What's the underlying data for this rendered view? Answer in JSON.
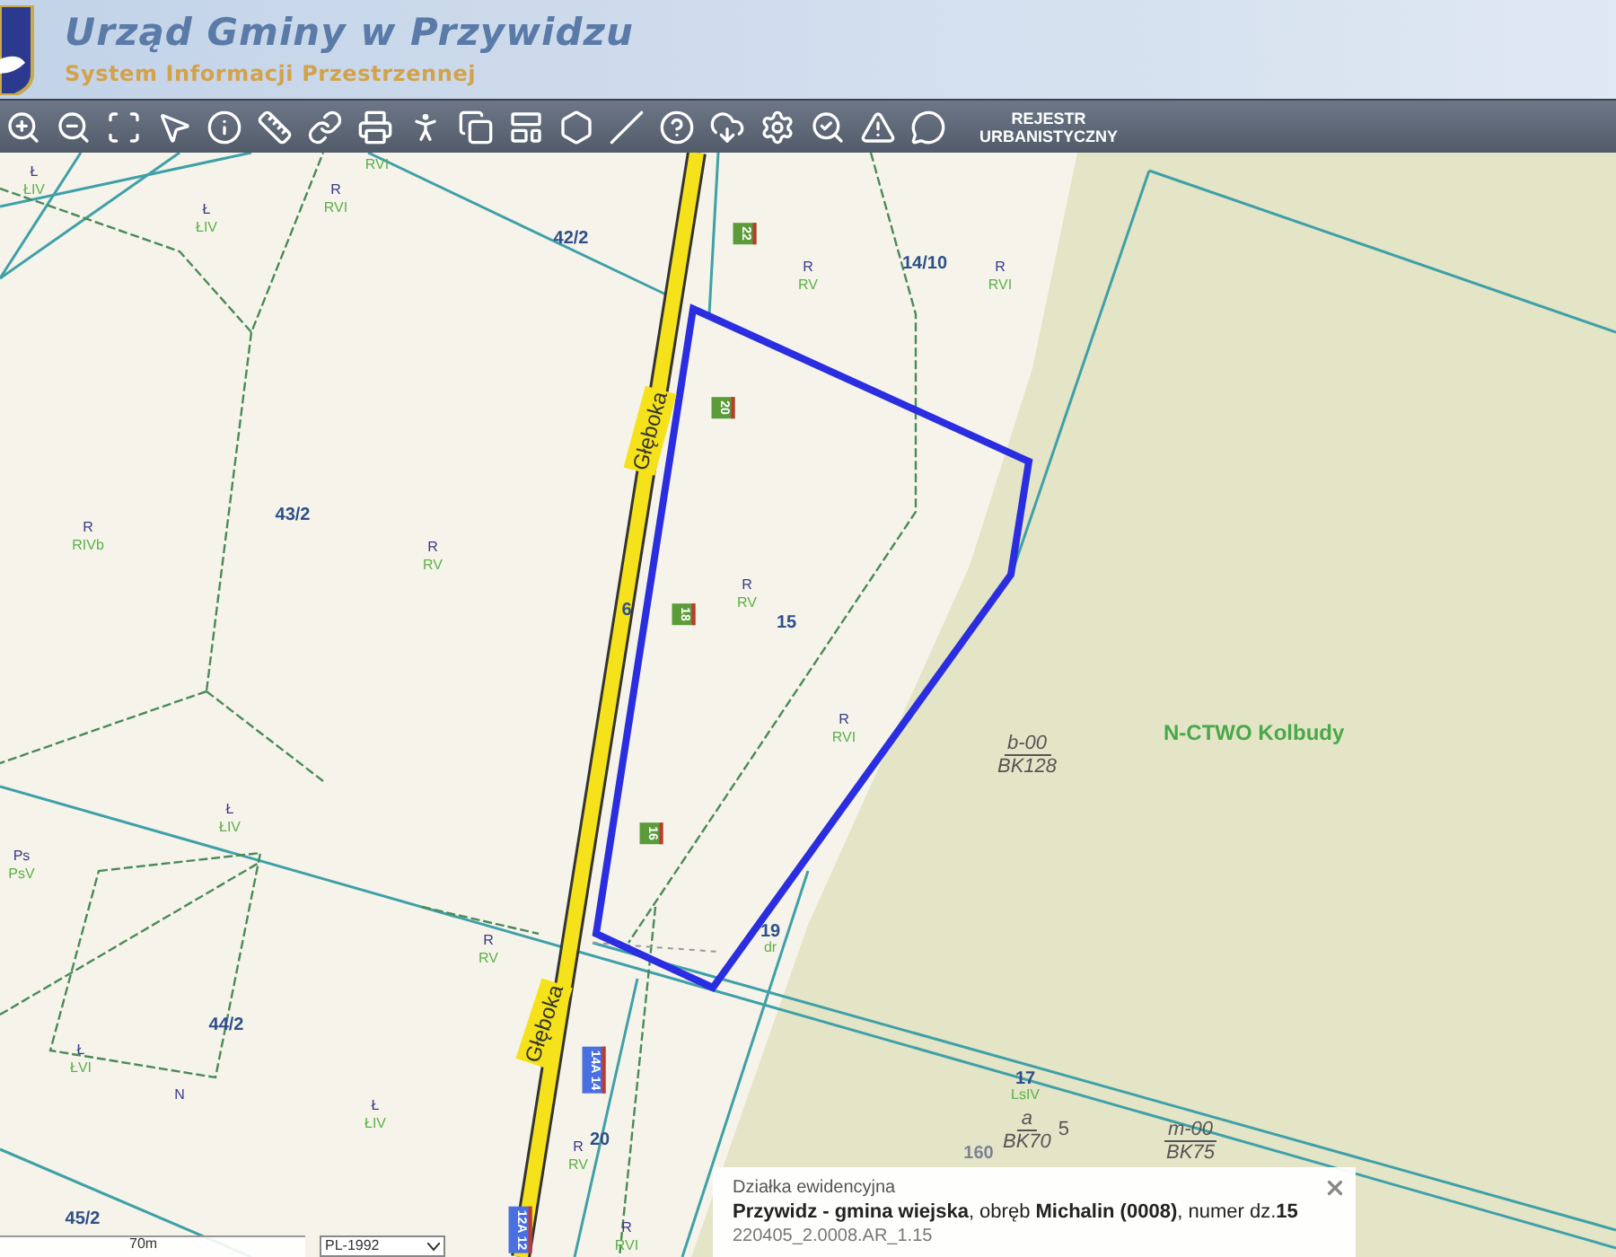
{
  "header": {
    "title": "Urząd Gminy w Przywidzu",
    "subtitle": "System Informacji Przestrzennej"
  },
  "toolbar": {
    "register_button": "REJESTR URBANISTYCZNY"
  },
  "map": {
    "parcels": [
      "42/2",
      "14/10",
      "43/2",
      "15",
      "44/2",
      "45/2",
      "19",
      "20",
      "17",
      "6"
    ],
    "land_use": [
      {
        "class": "Ł",
        "subclass": "ŁIV"
      },
      {
        "subclass": "RVI"
      },
      {
        "class": "Ł",
        "subclass": "ŁIV"
      },
      {
        "class": "R",
        "subclass": "RVI"
      },
      {
        "class": "R",
        "subclass": "RV"
      },
      {
        "class": "R",
        "subclass": "RVI"
      },
      {
        "class": "R",
        "subclass": "RIVb"
      },
      {
        "class": "R",
        "subclass": "RV"
      },
      {
        "class": "R",
        "subclass": "RV"
      },
      {
        "class": "R",
        "subclass": "RVI"
      },
      {
        "class": "Ł",
        "subclass": "ŁIV"
      },
      {
        "class": "Ps",
        "subclass": "PsV"
      },
      {
        "class": "R",
        "subclass": "RV"
      },
      {
        "class": "Ł",
        "subclass": "ŁVI"
      },
      {
        "class": "N"
      },
      {
        "class": "Ł",
        "subclass": "ŁIV"
      },
      {
        "class": "R",
        "subclass": "RV"
      },
      {
        "class": "R",
        "subclass": "RVI"
      },
      {
        "subclass": "dr"
      },
      {
        "subclass": "LsIV"
      }
    ],
    "streets": [
      "Głęboka",
      "Głęboka"
    ],
    "buildings": [
      {
        "number": "22",
        "color": "#5b9b3a"
      },
      {
        "number": "20",
        "color": "#5b9b3a"
      },
      {
        "number": "18",
        "color": "#5b9b3a"
      },
      {
        "number": "16",
        "color": "#5b9b3a"
      },
      {
        "number": "14A 14",
        "color": "#4a6fe0"
      },
      {
        "number": "12A 12",
        "color": "#4a6fe0"
      }
    ],
    "forest_name": "N-CTWO Kolbudy",
    "stands": [
      {
        "top": "b-00",
        "bottom": "BK128"
      },
      {
        "top": "a",
        "bottom": "BK70",
        "side": "5"
      },
      {
        "top": "m-00",
        "bottom": "BK75"
      }
    ],
    "extra_labels": [
      "160"
    ]
  },
  "scale": {
    "label": "70m",
    "crs": "PL-1992"
  },
  "popup": {
    "title": "Działka ewidencyjna",
    "description": "**Przywidz - gmina wiejska**, obręb **Michalin (0008)**, numer dz.**15**",
    "identifier": "220405_2.0008.AR_1.15"
  }
}
